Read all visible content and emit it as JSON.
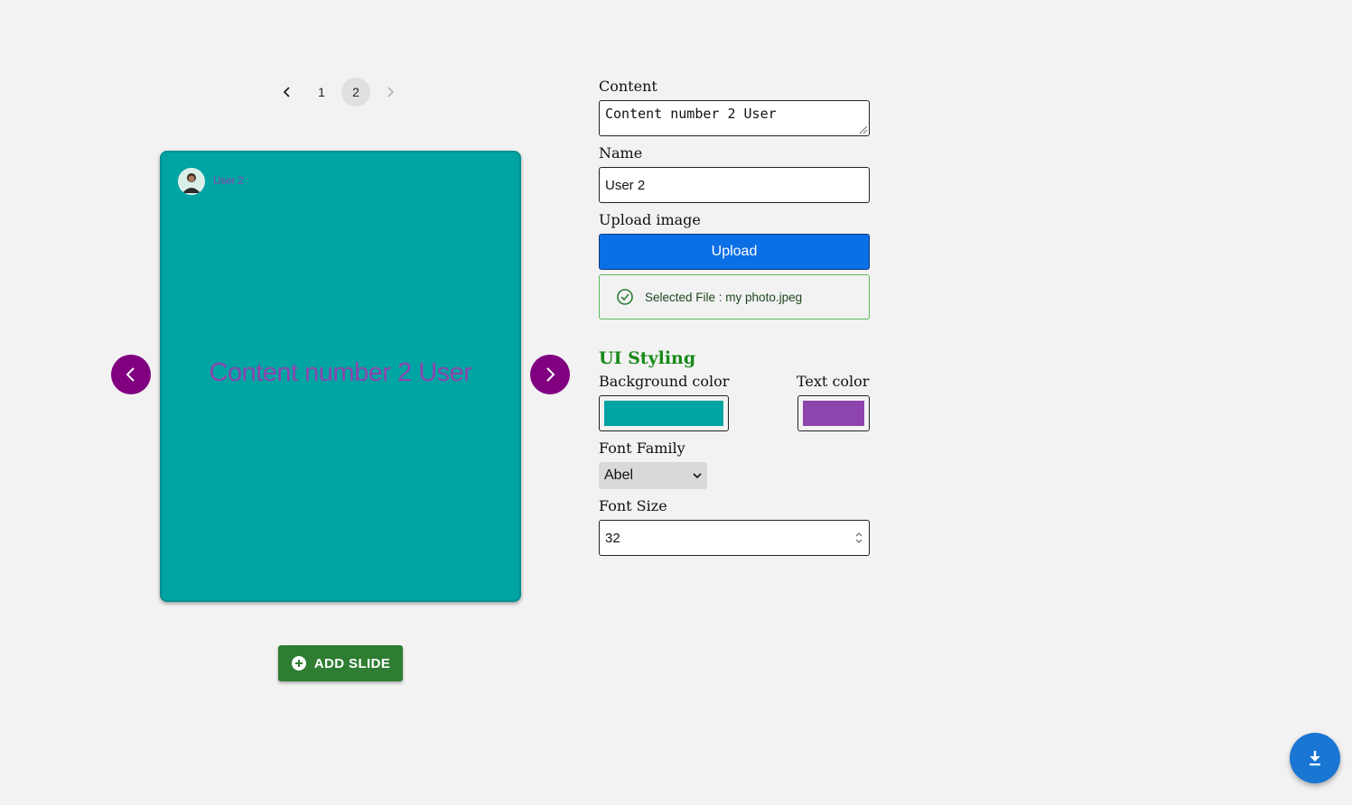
{
  "pagination": {
    "pages": [
      "1",
      "2"
    ],
    "current": "2"
  },
  "slide": {
    "user_name": "User 2",
    "content": "Content number 2 User",
    "background_color": "#00a4a3",
    "text_color": "#8e44ad"
  },
  "add_slide_label": "ADD SLIDE",
  "form": {
    "content_label": "Content",
    "content_value": "Content number 2 User",
    "name_label": "Name",
    "name_value": "User 2",
    "upload_label": "Upload image",
    "upload_button": "Upload",
    "selected_file": "Selected File : my photo.jpeg",
    "styling_title": "UI Styling",
    "bg_color_label": "Background color",
    "text_color_label": "Text color",
    "font_family_label": "Font Family",
    "font_family_value": "Abel",
    "font_size_label": "Font Size",
    "font_size_value": "32"
  },
  "icons": {
    "prev": "chevron-left-icon",
    "next": "chevron-right-icon",
    "add": "add-circle-icon",
    "download": "download-icon",
    "check": "check-circle-icon"
  }
}
